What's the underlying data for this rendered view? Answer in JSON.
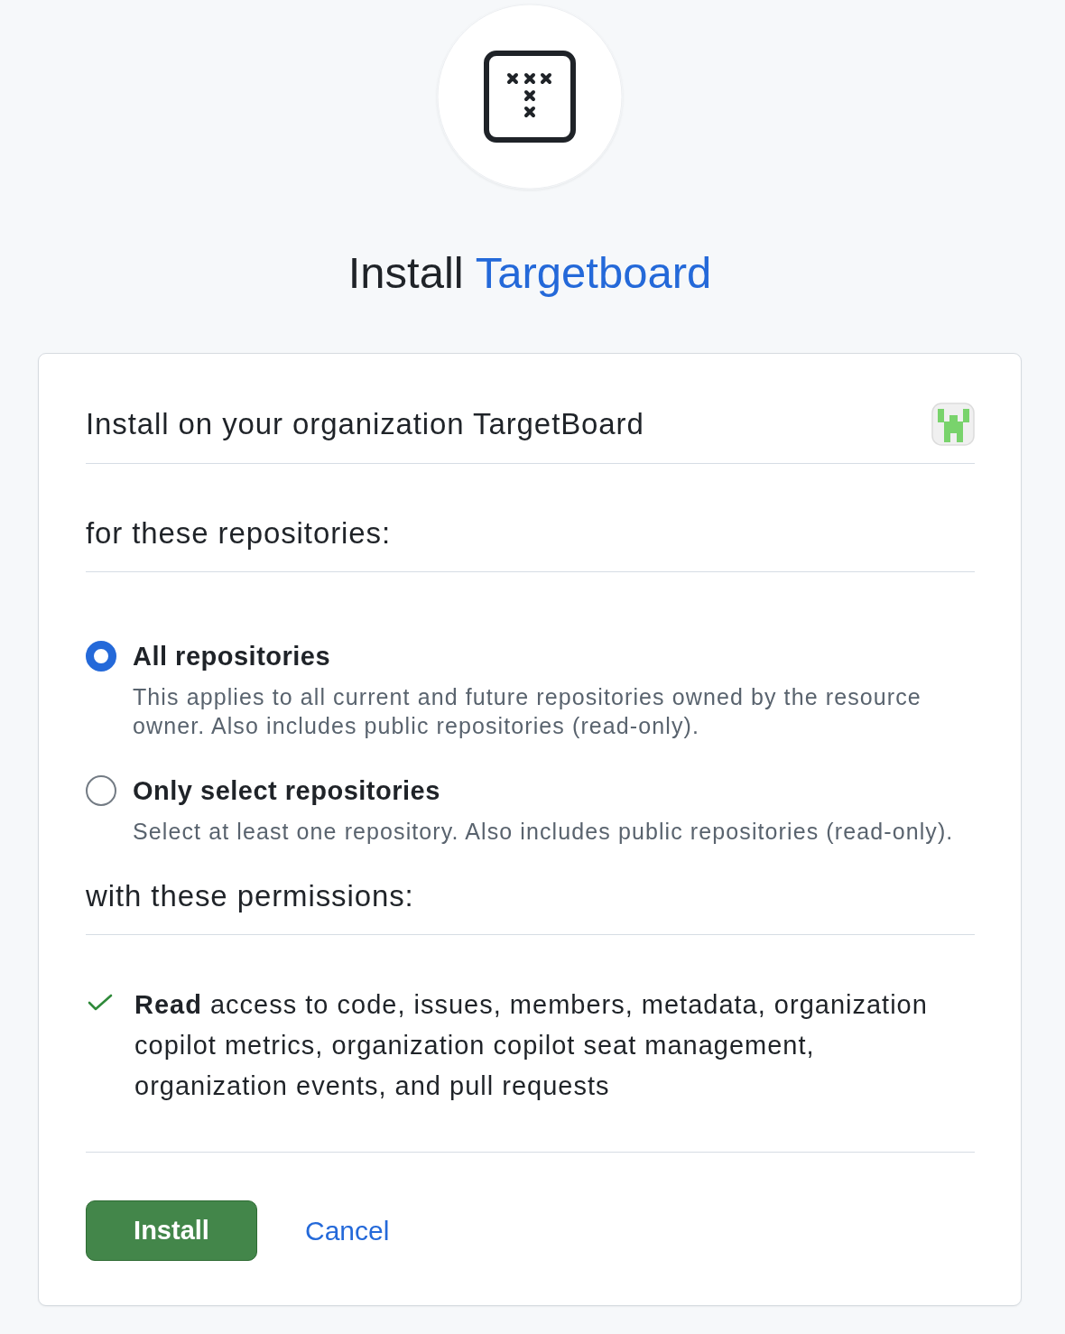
{
  "header": {
    "title_prefix": "Install",
    "app_link": "Targetboard"
  },
  "installation_target": {
    "label": "Install on your organization TargetBoard"
  },
  "repositories": {
    "heading": "for these repositories:",
    "options": [
      {
        "label": "All repositories",
        "description": "This applies to all current and future repositories owned by the resource owner. Also includes public repositories (read-only).",
        "selected": true
      },
      {
        "label": "Only select repositories",
        "description": "Select at least one repository. Also includes public repositories (read-only).",
        "selected": false
      }
    ]
  },
  "permissions": {
    "heading": "with these permissions:",
    "items": [
      {
        "text": "**Read** access to code, issues, members, metadata, organization copilot metrics, organization copilot seat management, organization events, and pull requests"
      }
    ]
  },
  "actions": {
    "install": "Install",
    "cancel": "Cancel"
  }
}
